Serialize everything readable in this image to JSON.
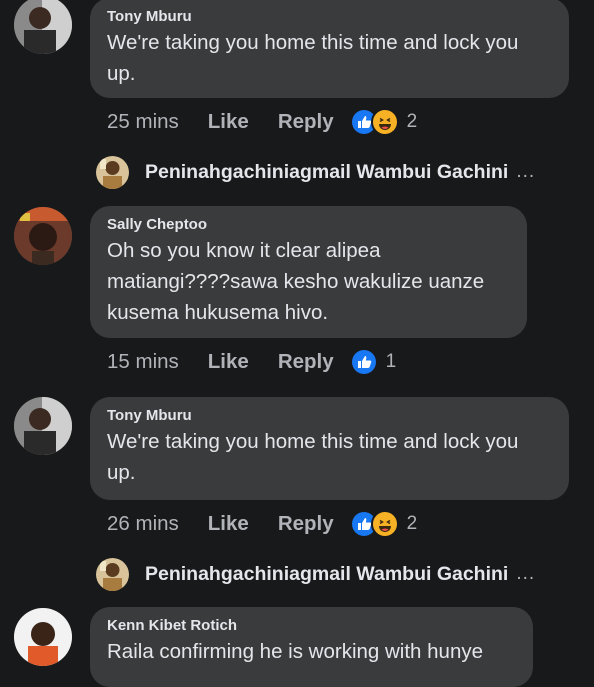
{
  "comments": [
    {
      "author": "Tony Mburu",
      "text": "We're taking you home this time and lock you up.",
      "time": "25 mins",
      "like_label": "Like",
      "reply_label": "Reply",
      "reactions": [
        "like",
        "haha"
      ],
      "reaction_count": "2"
    },
    {
      "author": "Sally Cheptoo",
      "text": "Oh so you know it clear alipea matiangi????sawa kesho wakulize uanze kusema hukusema hivo.",
      "time": "15 mins",
      "like_label": "Like",
      "reply_label": "Reply",
      "reactions": [
        "like"
      ],
      "reaction_count": "1"
    },
    {
      "author": "Tony Mburu",
      "text": "We're taking you home this time and lock you up.",
      "time": "26 mins",
      "like_label": "Like",
      "reply_label": "Reply",
      "reactions": [
        "like",
        "haha"
      ],
      "reaction_count": "2"
    },
    {
      "author": "Kenn Kibet Rotich",
      "text": "Raila confirming he is working with hunye"
    }
  ],
  "reply_previews": [
    {
      "name": "Peninahgachiniagmail Wambui Gachini",
      "more": "..."
    },
    {
      "name": "Peninahgachiniagmail Wambui Gachini",
      "more": "..."
    }
  ],
  "colors": {
    "background": "#18191a",
    "bubble": "#3a3b3c",
    "like_blue": "#1877f2",
    "haha_yellow": "#f7b125"
  }
}
